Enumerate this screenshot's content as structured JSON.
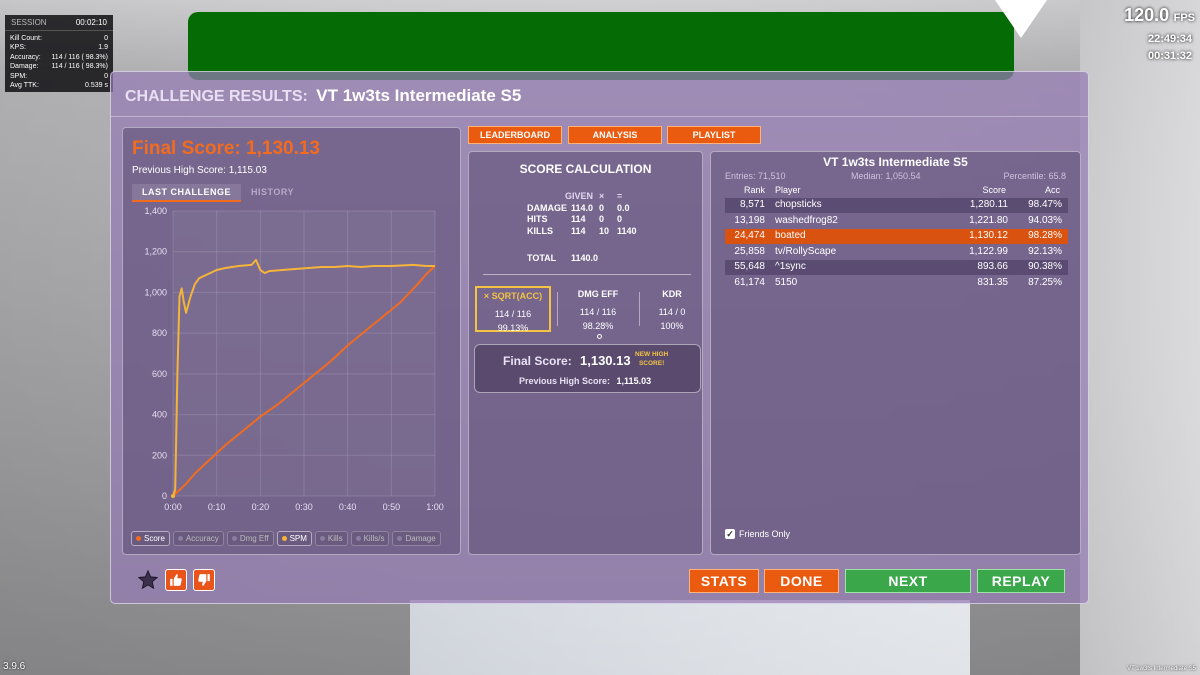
{
  "hud": {
    "session_label": "SESSION",
    "session_time": "00:02:10",
    "stats": [
      {
        "label": "Kill Count:",
        "value": "0"
      },
      {
        "label": "KPS:",
        "value": "1.9"
      },
      {
        "label": "Accuracy:",
        "value": "114 / 116 ( 98.3%)"
      },
      {
        "label": "Damage:",
        "value": "114 / 116 ( 98.3%)"
      },
      {
        "label": "SPM:",
        "value": "0"
      },
      {
        "label": "Avg TTK:",
        "value": "0.539 s"
      }
    ],
    "fps_value": "120.0",
    "fps_unit": "FPS",
    "clock_time": "22:49:34",
    "clock_elapsed": "00:31:32",
    "version": "3.9.6",
    "scenario_footer": "VT 1w3ts Intermediate S5"
  },
  "panel": {
    "title_prefix": "CHALLENGE RESULTS:",
    "scenario_name": "VT 1w3ts Intermediate S5"
  },
  "results": {
    "final_score_text": "Final Score: 1,130.13",
    "previous_high_text": "Previous High Score: 1,115.03",
    "tabs": [
      {
        "label": "LAST CHALLENGE",
        "active": true
      },
      {
        "label": "HISTORY",
        "active": false
      }
    ]
  },
  "chart_data": {
    "type": "line",
    "x_ticks": [
      "0:00",
      "0:10",
      "0:20",
      "0:30",
      "0:40",
      "0:50",
      "1:00"
    ],
    "y_ticks": [
      "0",
      "200",
      "400",
      "600",
      "800",
      "1,000",
      "1,200",
      "1,400"
    ],
    "xlim": [
      0,
      60
    ],
    "ylim": [
      0,
      1400
    ],
    "grid": true,
    "series": [
      {
        "name": "Score",
        "color": "#f26b1f",
        "x": [
          0,
          1,
          3,
          5,
          8,
          12,
          16,
          20,
          24,
          28,
          32,
          36,
          40,
          44,
          48,
          52,
          56,
          58,
          60
        ],
        "y": [
          0,
          20,
          60,
          110,
          170,
          250,
          320,
          390,
          450,
          520,
          590,
          660,
          740,
          810,
          880,
          950,
          1040,
          1090,
          1130
        ]
      },
      {
        "name": "SPM",
        "color": "#f4b43a",
        "x": [
          0,
          0.5,
          1,
          1.5,
          2,
          2.5,
          3,
          3.5,
          4,
          4.5,
          5,
          6,
          8,
          10,
          12,
          15,
          18,
          19,
          20,
          21,
          22,
          25,
          28,
          31,
          34,
          37,
          40,
          43,
          46,
          50,
          55,
          58,
          60
        ],
        "y": [
          0,
          30,
          600,
          980,
          1020,
          950,
          900,
          940,
          980,
          1010,
          1040,
          1070,
          1090,
          1110,
          1120,
          1130,
          1135,
          1160,
          1110,
          1095,
          1105,
          1110,
          1115,
          1120,
          1125,
          1125,
          1130,
          1125,
          1130,
          1130,
          1135,
          1130,
          1130
        ]
      }
    ]
  },
  "legend": [
    {
      "name": "Score",
      "color": "#f26b1f",
      "on": true
    },
    {
      "name": "Accuracy",
      "color": "#8a7ea0",
      "on": false
    },
    {
      "name": "Dmg Eff",
      "color": "#8a7ea0",
      "on": false
    },
    {
      "name": "SPM",
      "color": "#f4b43a",
      "on": true
    },
    {
      "name": "Kills",
      "color": "#8a7ea0",
      "on": false
    },
    {
      "name": "Kills/s",
      "color": "#8a7ea0",
      "on": false
    },
    {
      "name": "Damage",
      "color": "#8a7ea0",
      "on": false
    }
  ],
  "top_buttons": {
    "leaderboard": "LEADERBOARD",
    "analysis": "ANALYSIS",
    "playlist": "PLAYLIST"
  },
  "calc": {
    "title": "SCORE CALCULATION",
    "head": [
      "",
      "GIVEN",
      "×",
      "="
    ],
    "rows": [
      [
        "DAMAGE",
        "114.0",
        "0",
        "0.0"
      ],
      [
        "HITS",
        "114",
        "0",
        "0"
      ],
      [
        "KILLS",
        "114",
        "10",
        "1140"
      ]
    ],
    "total_label": "TOTAL",
    "total_value": "1140.0",
    "metrics": [
      {
        "name": "× SQRT(ACC)",
        "ratio": "114 / 116",
        "value": "99.13%",
        "highlight": true
      },
      {
        "name": "DMG EFF",
        "ratio": "114 / 116",
        "value": "98.28%",
        "highlight": false
      },
      {
        "name": "KDR",
        "ratio": "114 / 0",
        "value": "100%",
        "highlight": false
      }
    ],
    "final_label": "Final Score:",
    "final_value": "1,130.13",
    "new_high_line1": "NEW HIGH",
    "new_high_line2": "SCORE!",
    "prev_label": "Previous High Score:",
    "prev_value": "1,115.03"
  },
  "leaderboard": {
    "title": "VT 1w3ts Intermediate S5",
    "entries": "Entries: 71,510",
    "median": "Median: 1,050.54",
    "percentile": "Percentile: 65.8",
    "headers": {
      "rank": "Rank",
      "player": "Player",
      "score": "Score",
      "acc": "Acc"
    },
    "rows": [
      {
        "rank": "8,571",
        "player": "chopsticks",
        "score": "1,280.11",
        "acc": "98.47%"
      },
      {
        "rank": "13,198",
        "player": "washedfrog82",
        "score": "1,221.80",
        "acc": "94.03%"
      },
      {
        "rank": "24,474",
        "player": "boated",
        "score": "1,130.12",
        "acc": "98.28%"
      },
      {
        "rank": "25,858",
        "player": "tv/RollyScape",
        "score": "1,122.99",
        "acc": "92.13%"
      },
      {
        "rank": "55,648",
        "player": "^1sync",
        "score": "893.66",
        "acc": "90.38%"
      },
      {
        "rank": "61,174",
        "player": "5150",
        "score": "831.35",
        "acc": "87.25%"
      }
    ],
    "friends_only_label": "Friends Only",
    "friends_only_checked": true
  },
  "bottom": {
    "stats": "STATS",
    "done": "DONE",
    "next": "NEXT",
    "replay": "REPLAY"
  },
  "colors": {
    "accent_orange": "#ea5a0f",
    "highlight_yellow": "#f3c343",
    "button_green": "#3aa84a",
    "target_green": "#056b05"
  }
}
